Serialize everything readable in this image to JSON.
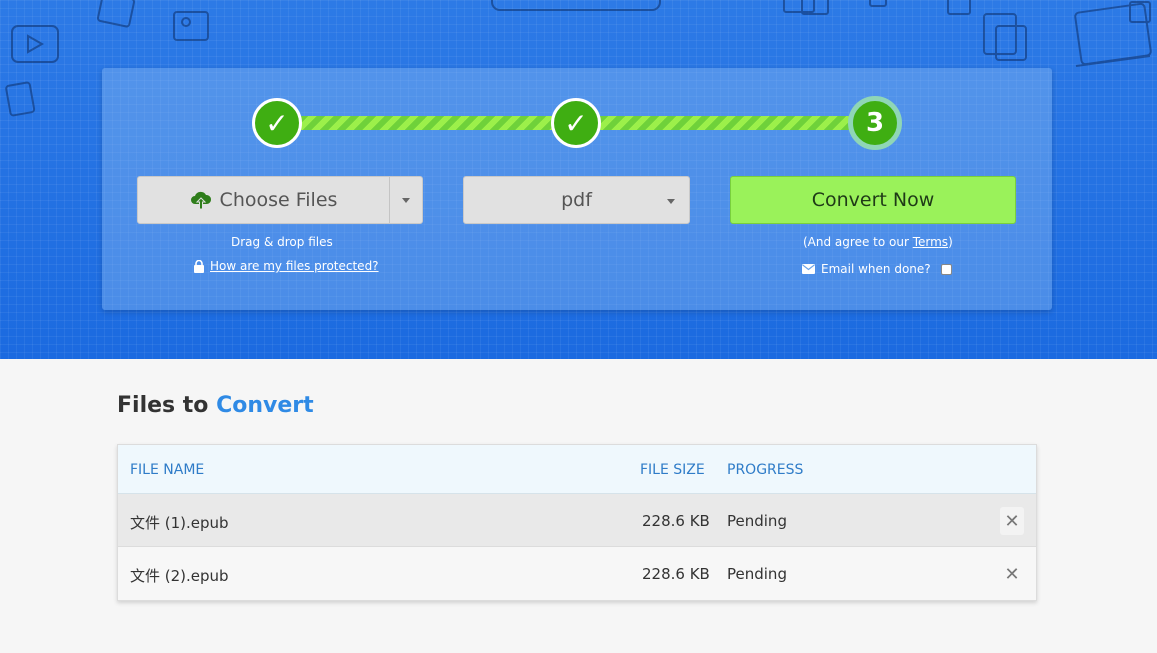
{
  "colors": {
    "hero_blue": "#1f6fe0",
    "step_green": "#3fae12",
    "convert_green": "#9af25a",
    "accent_blue": "#2f8ae5"
  },
  "steps": [
    {
      "label": "✓",
      "state": "done"
    },
    {
      "label": "✓",
      "state": "done"
    },
    {
      "label": "3",
      "state": "current"
    }
  ],
  "choose_files": {
    "icon": "cloud-upload-icon",
    "label": "Choose Files",
    "drag_hint": "Drag & drop files",
    "protect_link": "How are my files protected?"
  },
  "format": {
    "selected": "pdf"
  },
  "convert": {
    "label": "Convert Now",
    "agree_prefix": "(And agree to our ",
    "terms_link": "Terms",
    "agree_suffix": ")",
    "email_label": "Email when done?"
  },
  "files": {
    "title_prefix": "Files to",
    "title_accent": "Convert",
    "headers": {
      "name": "FILE NAME",
      "size": "FILE SIZE",
      "progress": "PROGRESS"
    },
    "rows": [
      {
        "name": "文件 (1).epub",
        "size": "228.6 KB",
        "progress": "Pending"
      },
      {
        "name": "文件 (2).epub",
        "size": "228.6 KB",
        "progress": "Pending"
      }
    ]
  }
}
